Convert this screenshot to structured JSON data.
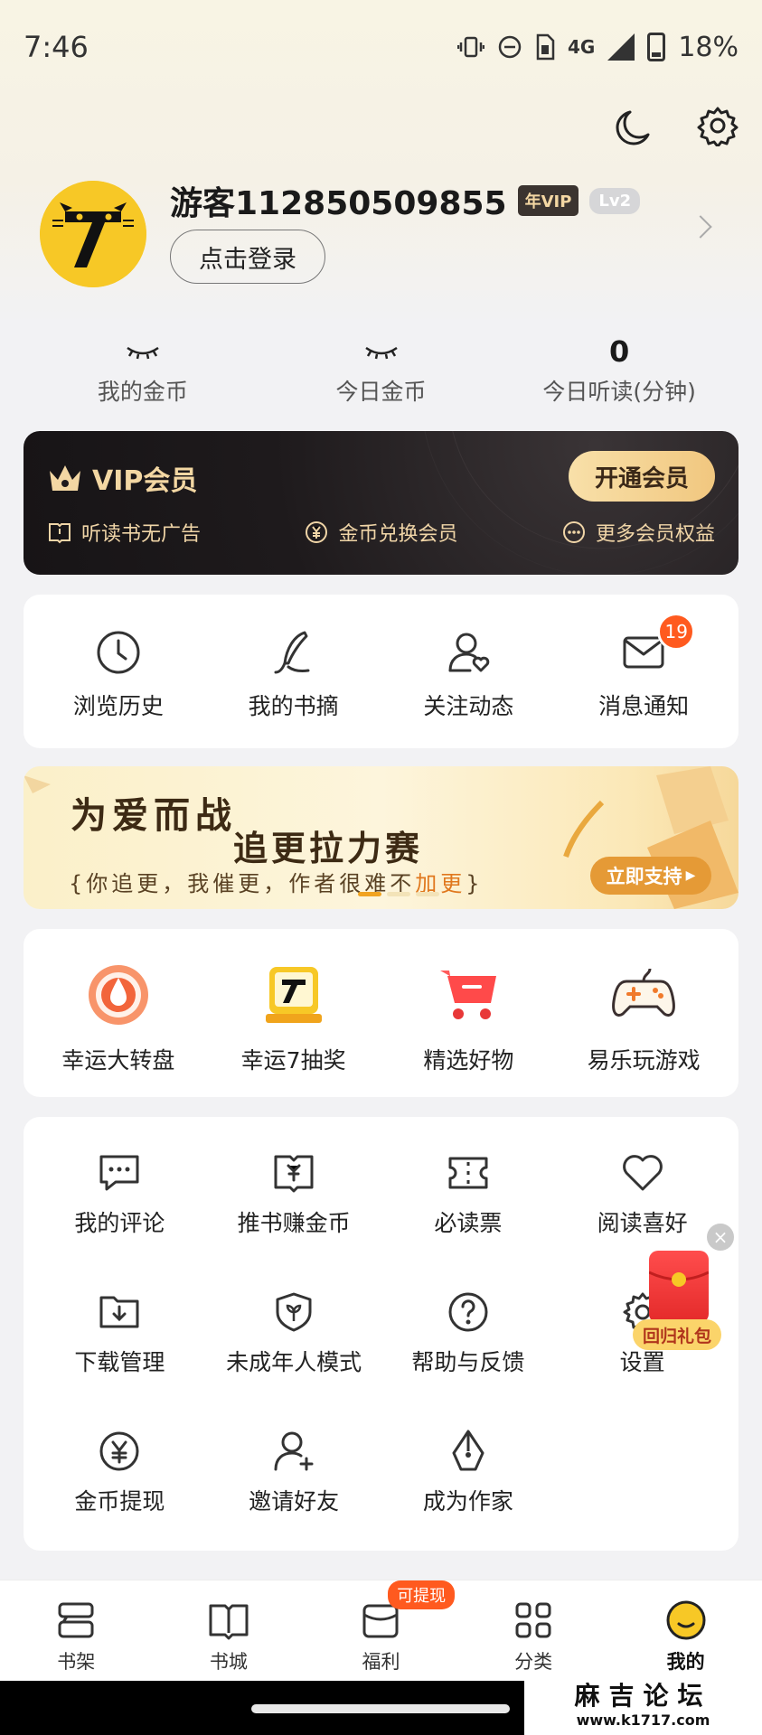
{
  "status_bar": {
    "time": "7:46",
    "network": "4G",
    "battery": "18%"
  },
  "profile": {
    "username": "游客112850509855",
    "vip_badge": "年VIP",
    "level": "Lv2",
    "login_label": "点击登录"
  },
  "stats": [
    {
      "value": "",
      "label": "我的金币"
    },
    {
      "value": "",
      "label": "今日金币"
    },
    {
      "value": "0",
      "label": "今日听读(分钟)"
    }
  ],
  "vip": {
    "title": "VIP会员",
    "button": "开通会员",
    "perks": [
      "听读书无广告",
      "金币兑换会员",
      "更多会员权益"
    ]
  },
  "quick_actions": [
    {
      "label": "浏览历史",
      "icon": "clock-icon"
    },
    {
      "label": "我的书摘",
      "icon": "feather-pen-icon"
    },
    {
      "label": "关注动态",
      "icon": "user-heart-icon"
    },
    {
      "label": "消息通知",
      "icon": "envelope-icon",
      "badge": "19"
    }
  ],
  "banner": {
    "title": "为爱而战",
    "subtitle": "追更拉力赛",
    "tagline_prefix": "{你追更，我催更，作者很难不",
    "tagline_accent": "加更",
    "tagline_suffix": "}",
    "button": "立即支持"
  },
  "fun_items": [
    {
      "label": "幸运大转盘",
      "icon": "lucky-wheel-icon"
    },
    {
      "label": "幸运7抽奖",
      "icon": "lucky-7-icon"
    },
    {
      "label": "精选好物",
      "icon": "shopping-cart-icon"
    },
    {
      "label": "易乐玩游戏",
      "icon": "gamepad-icon"
    }
  ],
  "services": [
    {
      "label": "我的评论",
      "icon": "comment-icon"
    },
    {
      "label": "推书赚金币",
      "icon": "book-coin-icon"
    },
    {
      "label": "必读票",
      "icon": "ticket-icon"
    },
    {
      "label": "阅读喜好",
      "icon": "heart-icon"
    },
    {
      "label": "下载管理",
      "icon": "download-folder-icon"
    },
    {
      "label": "未成年人模式",
      "icon": "shield-sprout-icon"
    },
    {
      "label": "帮助与反馈",
      "icon": "help-icon"
    },
    {
      "label": "设置",
      "icon": "settings-icon"
    },
    {
      "label": "金币提现",
      "icon": "coin-withdraw-icon"
    },
    {
      "label": "邀请好友",
      "icon": "invite-user-icon"
    },
    {
      "label": "成为作家",
      "icon": "pen-nib-icon"
    }
  ],
  "floating_gift": {
    "label": "回归礼包",
    "close": "×"
  },
  "bottom_nav": [
    {
      "label": "书架",
      "icon": "bookshelf-icon"
    },
    {
      "label": "书城",
      "icon": "open-book-icon"
    },
    {
      "label": "福利",
      "icon": "gift-envelope-icon",
      "badge": "可提现"
    },
    {
      "label": "分类",
      "icon": "grid-icon"
    },
    {
      "label": "我的",
      "icon": "smiley-icon",
      "active": true
    }
  ],
  "watermark": {
    "title": "麻吉论坛",
    "url": "www.k1717.com"
  },
  "colors": {
    "accent": "#ff5a1f",
    "vip_gold": "#f3d7a3",
    "avatar_yellow": "#f7c826"
  }
}
